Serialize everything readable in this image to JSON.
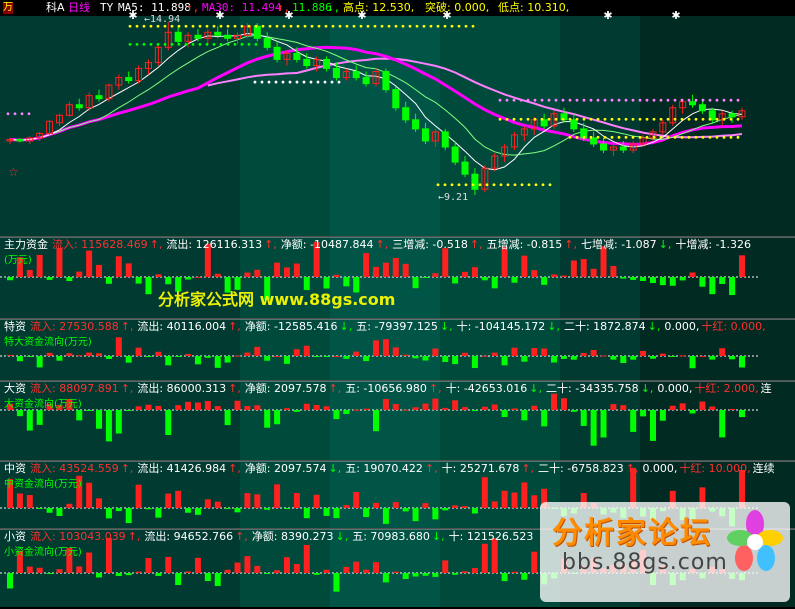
{
  "colors": {
    "up": "#ff2020",
    "down": "#00ff00",
    "ma5": "#ffffff",
    "ma30": "#ff00ff",
    "ma10": "#80ff80",
    "ma60": "#ff80ff",
    "label_yellow": "#ffff00",
    "label_red": "#ff3030",
    "label_white": "#ffffff",
    "label_green": "#00ff00",
    "watermark": "#ffff00"
  },
  "header": {
    "icon": "万",
    "t1": "科A",
    "period": "日线",
    "ty": "TY",
    "ma5_label": "MA5: 11.898",
    "ma5_arrow": "↑,",
    "ma30_label": "MA30: 11.494",
    "ma30_arrow": "↑,",
    "ma_extra": "11.886",
    "ma_extra_arrow": "↓,",
    "high_label": "高点: 12.530,",
    "break_label": "突破: 0.000,",
    "low_label": "低点: 10.310,"
  },
  "price_notes": {
    "high": "←14.94",
    "low": "←9.21"
  },
  "panels": [
    {
      "title": "主力资金",
      "fields": [
        {
          "t": "流入: 115628.469",
          "c": "red"
        },
        {
          "t": "↑,",
          "c": "red"
        },
        {
          "t": "流出: 126116.313",
          "c": "white"
        },
        {
          "t": "↑,",
          "c": "red"
        },
        {
          "t": "净额: -10487.844",
          "c": "white"
        },
        {
          "t": "↑,",
          "c": "red"
        },
        {
          "t": "三增减: -0.518",
          "c": "white"
        },
        {
          "t": "↑,",
          "c": "red"
        },
        {
          "t": "五增减: -0.815",
          "c": "white"
        },
        {
          "t": "↑,",
          "c": "red"
        },
        {
          "t": "七增减: -1.087",
          "c": "white"
        },
        {
          "t": "↓,",
          "c": "green"
        },
        {
          "t": "十增减: -1.326",
          "c": "white"
        }
      ],
      "subtitle": "(万元)"
    },
    {
      "title": "特资",
      "fields": [
        {
          "t": "流入: 27530.588",
          "c": "red"
        },
        {
          "t": "↑,",
          "c": "red"
        },
        {
          "t": "流出: 40116.004",
          "c": "white"
        },
        {
          "t": "↑,",
          "c": "red"
        },
        {
          "t": "净额: -12585.416",
          "c": "white"
        },
        {
          "t": "↓,",
          "c": "green"
        },
        {
          "t": "五: -79397.125",
          "c": "white"
        },
        {
          "t": "↓,",
          "c": "green"
        },
        {
          "t": "十: -104145.172",
          "c": "white"
        },
        {
          "t": "↓,",
          "c": "green"
        },
        {
          "t": "二十: 1872.874",
          "c": "white"
        },
        {
          "t": "↓,",
          "c": "green"
        },
        {
          "t": "0.000,",
          "c": "white"
        },
        {
          "t": "十红: 0.000,",
          "c": "red"
        }
      ],
      "subtitle": "特大资金流向(万元)"
    },
    {
      "title": "大资",
      "fields": [
        {
          "t": "流入: 88097.891",
          "c": "red"
        },
        {
          "t": "↑,",
          "c": "red"
        },
        {
          "t": "流出: 86000.313",
          "c": "white"
        },
        {
          "t": "↑,",
          "c": "red"
        },
        {
          "t": "净额: 2097.578",
          "c": "white"
        },
        {
          "t": "↑,",
          "c": "red"
        },
        {
          "t": "五: -10656.980",
          "c": "white"
        },
        {
          "t": "↑,",
          "c": "red"
        },
        {
          "t": "十: -42653.016",
          "c": "white"
        },
        {
          "t": "↓,",
          "c": "green"
        },
        {
          "t": "二十: -34335.758",
          "c": "white"
        },
        {
          "t": "↓,",
          "c": "green"
        },
        {
          "t": "0.000,",
          "c": "white"
        },
        {
          "t": "十红: 2.000,",
          "c": "red"
        },
        {
          "t": "连",
          "c": "white"
        }
      ],
      "subtitle": "大资金流向(万元)"
    },
    {
      "title": "中资",
      "fields": [
        {
          "t": "流入: 43524.559",
          "c": "red"
        },
        {
          "t": "↑,",
          "c": "red"
        },
        {
          "t": "流出: 41426.984",
          "c": "white"
        },
        {
          "t": "↑,",
          "c": "red"
        },
        {
          "t": "净额: 2097.574",
          "c": "white"
        },
        {
          "t": "↓,",
          "c": "green"
        },
        {
          "t": "五: 19070.422",
          "c": "white"
        },
        {
          "t": "↑,",
          "c": "red"
        },
        {
          "t": "十: 25271.678",
          "c": "white"
        },
        {
          "t": "↑,",
          "c": "red"
        },
        {
          "t": "二十: -6758.823",
          "c": "white"
        },
        {
          "t": "↑,",
          "c": "red"
        },
        {
          "t": "0.000,",
          "c": "white"
        },
        {
          "t": "十红: 10.000,",
          "c": "red"
        },
        {
          "t": "连续",
          "c": "white"
        }
      ],
      "subtitle": "中资金流向(万元)"
    },
    {
      "title": "小资",
      "fields": [
        {
          "t": "流入: 103043.039",
          "c": "red"
        },
        {
          "t": "↑,",
          "c": "red"
        },
        {
          "t": "流出: 94652.766",
          "c": "white"
        },
        {
          "t": "↑,",
          "c": "red"
        },
        {
          "t": "净额: 8390.273",
          "c": "white"
        },
        {
          "t": "↓,",
          "c": "green"
        },
        {
          "t": "五: 70983.680",
          "c": "white"
        },
        {
          "t": "↓,",
          "c": "green"
        },
        {
          "t": "十: 121526.523",
          "c": "white"
        }
      ],
      "subtitle": "小资金流向(万元)"
    }
  ],
  "watermark": "分析家公式网 www.88gs.com",
  "logo": {
    "title": "分析家论坛",
    "url": "bbs.88gs.com"
  },
  "chart_data": {
    "type": "candlestick",
    "price_range": [
      9.21,
      14.94
    ],
    "candles": [
      [
        11.0,
        11.1,
        10.9,
        11.05
      ],
      [
        11.05,
        11.1,
        10.95,
        11.0
      ],
      [
        11.0,
        11.15,
        10.9,
        11.1
      ],
      [
        11.1,
        11.3,
        11.0,
        11.25
      ],
      [
        11.25,
        11.7,
        11.2,
        11.65
      ],
      [
        11.6,
        11.9,
        11.5,
        11.85
      ],
      [
        11.85,
        12.3,
        11.8,
        12.2
      ],
      [
        12.2,
        12.4,
        12.0,
        12.1
      ],
      [
        12.1,
        12.6,
        12.0,
        12.5
      ],
      [
        12.5,
        12.7,
        12.3,
        12.4
      ],
      [
        12.4,
        12.9,
        12.3,
        12.85
      ],
      [
        12.85,
        13.2,
        12.7,
        13.1
      ],
      [
        13.1,
        13.3,
        12.9,
        13.0
      ],
      [
        13.0,
        13.5,
        12.9,
        13.4
      ],
      [
        13.4,
        13.7,
        13.2,
        13.6
      ],
      [
        13.6,
        14.2,
        13.5,
        14.1
      ],
      [
        14.1,
        14.94,
        14.0,
        14.6
      ],
      [
        14.6,
        14.8,
        14.2,
        14.3
      ],
      [
        14.3,
        14.6,
        14.1,
        14.5
      ],
      [
        14.5,
        14.7,
        14.3,
        14.4
      ],
      [
        14.4,
        14.7,
        14.2,
        14.6
      ],
      [
        14.6,
        14.8,
        14.4,
        14.5
      ],
      [
        14.5,
        14.7,
        14.3,
        14.4
      ],
      [
        14.4,
        14.6,
        14.2,
        14.5
      ],
      [
        14.5,
        14.9,
        14.4,
        14.8
      ],
      [
        14.8,
        14.9,
        14.3,
        14.4
      ],
      [
        14.4,
        14.6,
        14.0,
        14.1
      ],
      [
        14.1,
        14.3,
        13.6,
        13.7
      ],
      [
        13.7,
        14.0,
        13.5,
        13.9
      ],
      [
        13.9,
        14.1,
        13.6,
        13.7
      ],
      [
        13.7,
        13.9,
        13.4,
        13.5
      ],
      [
        13.5,
        13.8,
        13.3,
        13.7
      ],
      [
        13.7,
        13.8,
        13.3,
        13.4
      ],
      [
        13.4,
        13.6,
        13.0,
        13.1
      ],
      [
        13.1,
        13.4,
        13.0,
        13.3
      ],
      [
        13.3,
        13.5,
        13.0,
        13.1
      ],
      [
        13.1,
        13.3,
        12.8,
        12.9
      ],
      [
        12.9,
        13.4,
        12.8,
        13.3
      ],
      [
        13.3,
        13.4,
        12.6,
        12.7
      ],
      [
        12.7,
        12.8,
        12.0,
        12.1
      ],
      [
        12.1,
        12.3,
        11.6,
        11.7
      ],
      [
        11.7,
        11.9,
        11.3,
        11.4
      ],
      [
        11.4,
        11.6,
        10.9,
        11.0
      ],
      [
        11.0,
        11.4,
        10.8,
        11.3
      ],
      [
        11.3,
        11.4,
        10.7,
        10.8
      ],
      [
        10.8,
        11.0,
        10.2,
        10.3
      ],
      [
        10.3,
        10.5,
        9.8,
        9.9
      ],
      [
        9.9,
        10.1,
        9.21,
        9.4
      ],
      [
        9.4,
        10.2,
        9.3,
        10.1
      ],
      [
        10.1,
        10.6,
        10.0,
        10.5
      ],
      [
        10.5,
        10.9,
        10.3,
        10.8
      ],
      [
        10.8,
        11.3,
        10.7,
        11.2
      ],
      [
        11.2,
        11.5,
        11.0,
        11.4
      ],
      [
        11.4,
        11.8,
        11.2,
        11.7
      ],
      [
        11.7,
        11.9,
        11.4,
        11.5
      ],
      [
        11.5,
        12.0,
        11.4,
        11.9
      ],
      [
        11.9,
        12.1,
        11.6,
        11.7
      ],
      [
        11.7,
        11.9,
        11.3,
        11.4
      ],
      [
        11.4,
        11.6,
        11.0,
        11.1
      ],
      [
        11.1,
        11.3,
        10.8,
        10.9
      ],
      [
        10.9,
        11.1,
        10.6,
        10.7
      ],
      [
        10.7,
        10.9,
        10.5,
        10.8
      ],
      [
        10.8,
        11.0,
        10.6,
        10.7
      ],
      [
        10.7,
        11.0,
        10.6,
        10.9
      ],
      [
        10.9,
        11.2,
        10.8,
        11.1
      ],
      [
        11.1,
        11.4,
        11.0,
        11.3
      ],
      [
        11.3,
        11.7,
        11.2,
        11.6
      ],
      [
        11.6,
        12.2,
        11.5,
        12.1
      ],
      [
        12.1,
        12.4,
        11.9,
        12.3
      ],
      [
        12.3,
        12.53,
        12.1,
        12.2
      ],
      [
        12.2,
        12.4,
        11.9,
        12.0
      ],
      [
        12.0,
        12.1,
        11.6,
        11.7
      ],
      [
        11.7,
        12.0,
        11.5,
        11.9
      ],
      [
        11.9,
        12.0,
        11.6,
        11.8
      ],
      [
        11.8,
        12.1,
        11.7,
        12.0
      ]
    ],
    "xlabel": "",
    "ylabel": ""
  }
}
